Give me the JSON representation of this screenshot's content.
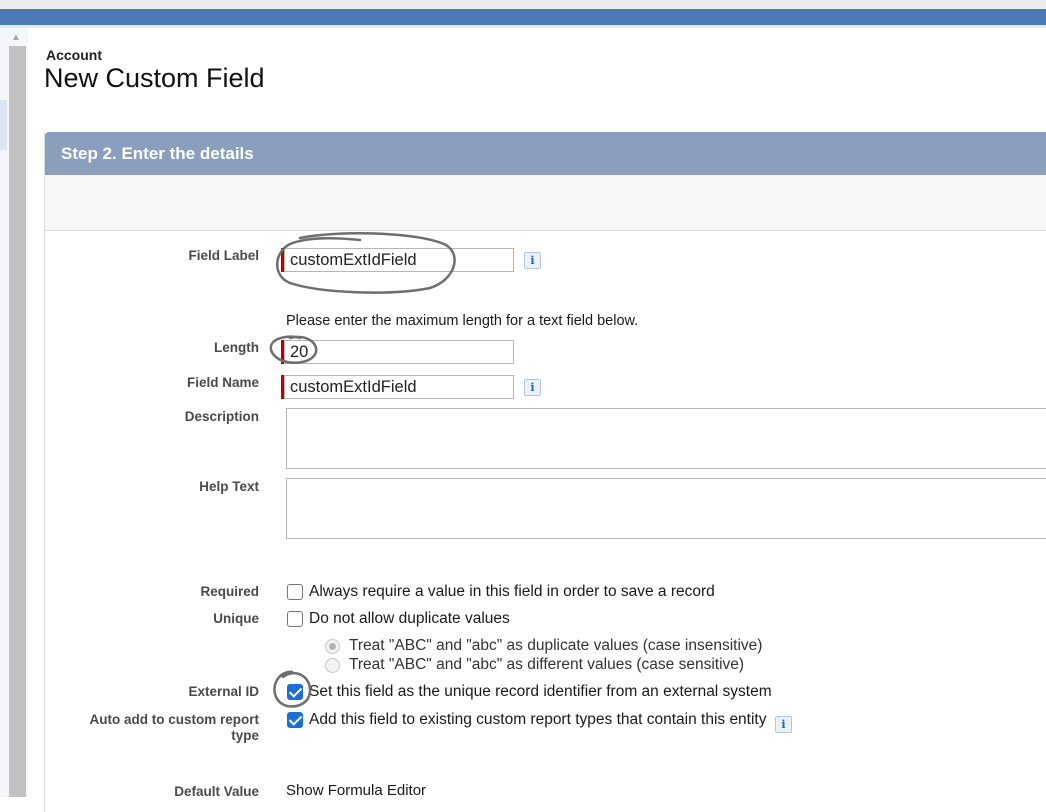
{
  "header": {
    "object_name": "Account",
    "title": "New Custom Field"
  },
  "step": {
    "title": "Step 2. Enter the details"
  },
  "fields": {
    "field_label": {
      "label": "Field Label",
      "value": "customExtIdField"
    },
    "length_hint": "Please enter the maximum length for a text field below.",
    "length": {
      "label": "Length",
      "value": "20"
    },
    "field_name": {
      "label": "Field Name",
      "value": "customExtIdField"
    },
    "description": {
      "label": "Description",
      "value": ""
    },
    "help_text": {
      "label": "Help Text",
      "value": ""
    }
  },
  "options": {
    "required": {
      "label": "Required",
      "text": "Always require a value in this field in order to save a record",
      "checked": false
    },
    "unique": {
      "label": "Unique",
      "text": "Do not allow duplicate values",
      "checked": false
    },
    "case_insensitive": {
      "text": "Treat \"ABC\" and \"abc\" as duplicate values (case insensitive)",
      "selected": true,
      "disabled": true
    },
    "case_sensitive": {
      "text": "Treat \"ABC\" and \"abc\" as different values (case sensitive)",
      "selected": false,
      "disabled": true
    },
    "external_id": {
      "label": "External ID",
      "text": "Set this field as the unique record identifier from an external system",
      "checked": true
    },
    "auto_add_report": {
      "label_line1": "Auto add to custom report",
      "label_line2": "type",
      "text": "Add this field to existing custom report types that contain this entity",
      "checked": true
    }
  },
  "default_value": {
    "label": "Default Value",
    "link": "Show Formula Editor"
  },
  "icons": {
    "info": "i",
    "scroll_up": "▲"
  },
  "colors": {
    "step_header": "#8a9ebe",
    "required_marker": "#c00000",
    "checkbox_checked": "#1b6ed6"
  }
}
